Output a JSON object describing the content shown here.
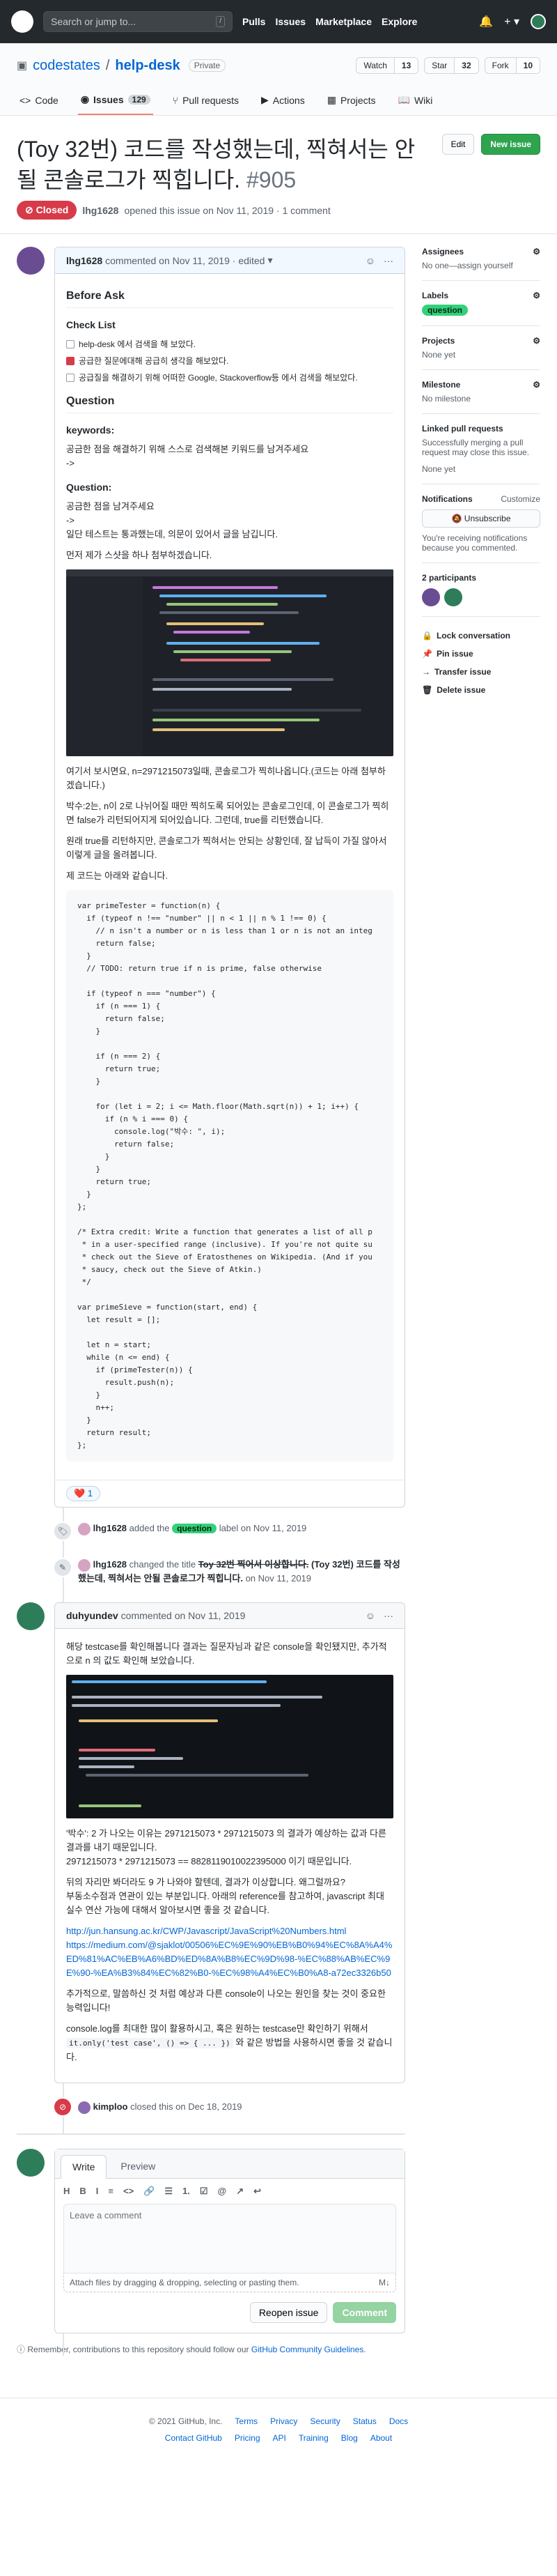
{
  "topbar": {
    "search_placeholder": "Search or jump to...",
    "search_key": "/",
    "nav": [
      "Pulls",
      "Issues",
      "Marketplace",
      "Explore"
    ],
    "bell_icon": "bell-icon",
    "plus_icon": "plus-icon"
  },
  "repo": {
    "owner": "codestates",
    "separator": "/",
    "name": "help-desk",
    "visibility": "Private",
    "watch_label": "Watch",
    "watch_count": "13",
    "star_label": "Star",
    "star_count": "32",
    "fork_label": "Fork",
    "fork_count": "10",
    "tabs": [
      {
        "label": "Code",
        "icon": "code-icon"
      },
      {
        "label": "Issues",
        "count": "129",
        "icon": "issue-icon"
      },
      {
        "label": "Pull requests",
        "icon": "pull-request-icon"
      },
      {
        "label": "Actions",
        "icon": "play-icon"
      },
      {
        "label": "Projects",
        "icon": "project-icon"
      },
      {
        "label": "Wiki",
        "icon": "book-icon"
      }
    ]
  },
  "issue": {
    "title": "(Toy 32번) 코드를 작성했는데, 찍혀서는 안될 콘솔로그가 찍힙니다.",
    "number": "#905",
    "edit_label": "Edit",
    "new_issue_label": "New issue",
    "state": "Closed",
    "author": "lhg1628",
    "opened_text": "opened this issue on Nov 11, 2019 · 1 comment"
  },
  "first_comment": {
    "author": "lhg1628",
    "meta": "commented on Nov 11, 2019 · edited",
    "heading": "Before Ask",
    "checklist_title": "Check List",
    "checklist": [
      {
        "text": "help-desk 에서 검색을 해 보았다.",
        "checked": false
      },
      {
        "text": "공급한 질문에대해 공급히 생각을 해보았다.",
        "checked": true
      },
      {
        "text": "공급질을 해결하기 위해 어떠한 Google, Stackoverflow등 에서 검색을 해보았다.",
        "checked": false
      }
    ],
    "question_heading": "Question",
    "keywords_label": "keywords:",
    "keywords_text": "공금한 점을 해결하기 위해 스스로 검색해본 키워드를 남겨주세요",
    "arrow1": "->",
    "question_label": "Question:",
    "q_lines": [
      "공금한 점을 남겨주세요",
      "->",
      "일단 테스트는 통과했는데, 의문이 있어서 글을 남깁니다."
    ],
    "screenshot_caption_before": "먼저 제가 스샷을 하나 첨부하겠습니다.",
    "p1": "여기서 보시면요, n=2971215073일때, 콘솔로그가 찍히나옵니다.(코드는 아래 첨부하겠습니다.)",
    "p2": "박수:2는, n이 2로 나뉘어질 때만 찍히도록 되어있는 콘솔로그인데, 이 콘솔로그가 찍히면 false가 리턴되어지게 되어있습니다. 그런데, true를 리턴했습니다.",
    "p3": "원래 true를 리턴하지만, 콘솔로그가 찍혀서는 안되는 상황인데, 잘 납득이 가질 않아서 이렇게 글을 올려봅니다.",
    "p4": "제 코드는 아래와 같습니다.",
    "code": "var primeTester = function(n) {\n  if (typeof n !== \"number\" || n < 1 || n % 1 !== 0) {\n    // n isn't a number or n is less than 1 or n is not an integ\n    return false;\n  }\n  // TODO: return true if n is prime, false otherwise\n\n  if (typeof n === \"number\") {\n    if (n === 1) {\n      return false;\n    }\n\n    if (n === 2) {\n      return true;\n    }\n\n    for (let i = 2; i <= Math.floor(Math.sqrt(n)) + 1; i++) {\n      if (n % i === 0) {\n        console.log(\"박수: \", i);\n        return false;\n      }\n    }\n    return true;\n  }\n};\n\n/* Extra credit: Write a function that generates a list of all p\n * in a user-specified range (inclusive). If you're not quite su\n * check out the Sieve of Eratosthenes on Wikipedia. (And if you\n * saucy, check out the Sieve of Atkin.)\n */\n\nvar primeSieve = function(start, end) {\n  let result = [];\n\n  let n = start;\n  while (n <= end) {\n    if (primeTester(n)) {\n      result.push(n);\n    }\n    n++;\n  }\n  return result;\n};",
    "reaction_emoji": "❤️",
    "reaction_count": "1"
  },
  "events": [
    {
      "actor": "lhg1628",
      "before": "added the",
      "label": "question",
      "after": "label on Nov 11, 2019"
    },
    {
      "actor": "lhg1628",
      "before": "changed the title",
      "old_title": "Toy 32번 찍어서 이상합니다.",
      "new_title": "(Toy 32번) 코드를 작성했는데, 찍혀서는 안될 콘솔로그가 찍힙니다.",
      "after": "on Nov 11, 2019"
    }
  ],
  "second_comment": {
    "author": "duhyundev",
    "meta": "commented on Nov 11, 2019",
    "intro": "해당 testcase를 확인해봅니다 결과는 질문자님과 같은 console을 확인됐지만, 추가적으로 n 의 값도 확인해 보았습니다.",
    "p1": "'박수': 2 가 나오는 이유는 2971215073 * 2971215073 의 결과가 예상하는 값과 다른 결과를 내기 때문입니다.",
    "p1b": "2971215073 * 2971215073 == 8828119010022395000 이기 때문입니다.",
    "p2": "뒤의 자리만 봐더라도 9 가 나와야 할텐데, 결과가 이상합니다. 왜그럴까요?",
    "p2b": "부동소수점과 연관이 있는 부분입니다. 아래의 reference를 참고하여, javascript 최대 실수 연산 가능에 대해서 알아보시면 좋을 것 같습니다.",
    "link1": "http://jun.hansung.ac.kr/CWP/Javascript/JavaScript%20Numbers.html",
    "link2": "https://medium.com/@sjaklot/00506%EC%9E%90%EB%B0%94%EC%8A%A4%ED%81%AC%EB%A6%BD%ED%8A%B8%EC%9D%98-%EC%88%AB%EC%9E%90-%EA%B3%84%EC%82%B0-%EC%98%A4%EC%B0%A8-a72ec3326b50",
    "p3": "추가적으로, 말씀하신 것 처럼 예상과 다른 console이 나오는 원인을 찾는 것이 중요한 능력입니다!",
    "p4": "console.log를 최대한 많이 활용하시고, 혹은 원하는 testcase만 확인하기 위해서",
    "p4_code": "it.only('test case', () => { ... })",
    "p4_end": "와 같은 방법을 사용하시면 좋을 것 같습니다."
  },
  "close_event": {
    "actor": "kimploo",
    "text": "closed this on Dec 18, 2019"
  },
  "new_comment": {
    "write_tab": "Write",
    "preview_tab": "Preview",
    "toolbar": [
      "H",
      "B",
      "I",
      "≡",
      "<>",
      "🔗",
      "☰",
      "1.",
      "☑",
      "@",
      "↗",
      "↩"
    ],
    "placeholder": "Leave a comment",
    "attach_text": "Attach files by dragging & dropping, selecting or pasting them.",
    "markdown_icon": "markdown-icon",
    "reopen_label": "Reopen issue",
    "comment_label": "Comment",
    "tip_prefix": "Remember, contributions to this repository should follow our",
    "tip_link": "GitHub Community Guidelines",
    "tip_suffix": "."
  },
  "sidebar": {
    "assignees_title": "Assignees",
    "assignees_value": "No one—assign yourself",
    "labels_title": "Labels",
    "label": "question",
    "projects_title": "Projects",
    "projects_value": "None yet",
    "milestone_title": "Milestone",
    "milestone_value": "No milestone",
    "linked_title": "Linked pull requests",
    "linked_value": "Successfully merging a pull request may close this issue.",
    "linked_none": "None yet",
    "notifications_title": "Notifications",
    "customize": "Customize",
    "unsubscribe": "Unsubscribe",
    "notif_text": "You're receiving notifications because you commented.",
    "participants": "2 participants",
    "actions": [
      "Lock conversation",
      "Pin issue",
      "Transfer issue",
      "Delete issue"
    ]
  },
  "footer": {
    "copyright": "© 2021 GitHub, Inc.",
    "row1": [
      "Terms",
      "Privacy",
      "Security",
      "Status",
      "Docs"
    ],
    "row2": [
      "Contact GitHub",
      "Pricing",
      "API",
      "Training",
      "Blog",
      "About"
    ]
  },
  "colors": {
    "closed": "#d73a49",
    "label_question": "#33d17a",
    "primary": "#2ea44f",
    "link": "#0366d6"
  }
}
